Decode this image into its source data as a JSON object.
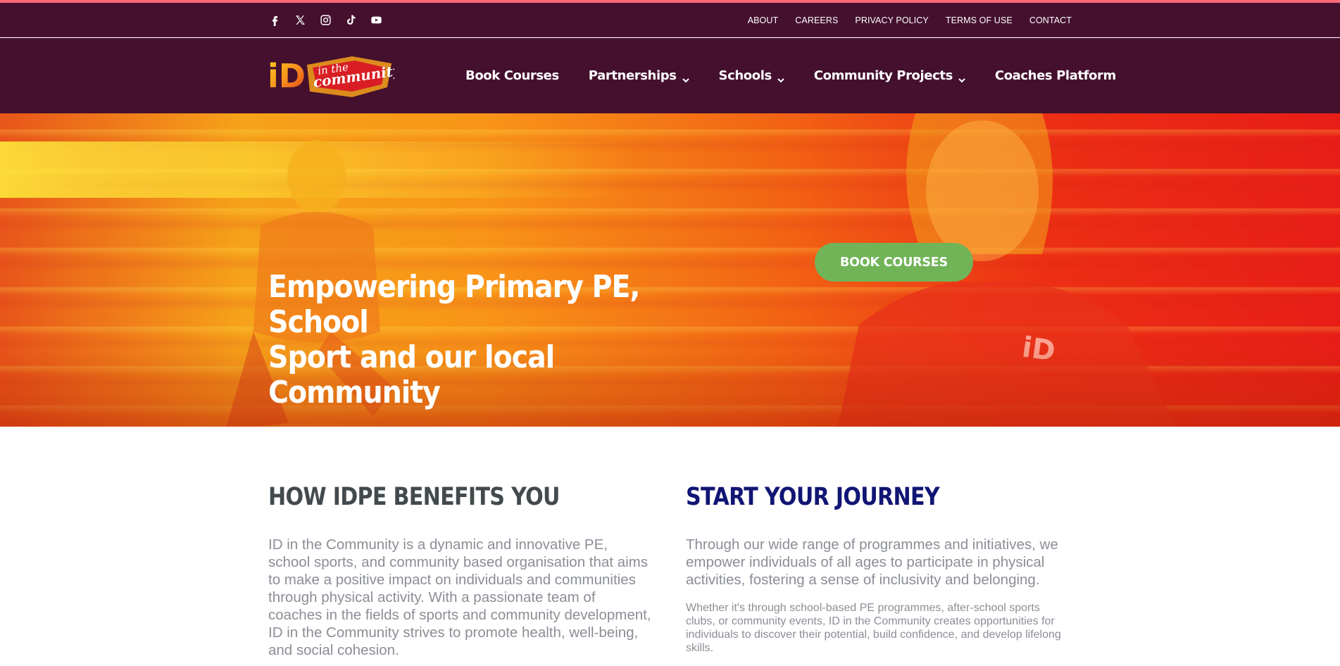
{
  "colors": {
    "topbar_bg": "#44102e",
    "accent_line": "#ff6a7a",
    "button_green": "#71b458",
    "heading_dark": "#424a4e",
    "heading_navy": "#111574",
    "body_text": "#8b8e96"
  },
  "social": [
    {
      "icon": "facebook-icon"
    },
    {
      "icon": "x-twitter-icon"
    },
    {
      "icon": "instagram-icon"
    },
    {
      "icon": "tiktok-icon"
    },
    {
      "icon": "youtube-icon"
    }
  ],
  "top_links": {
    "about": "ABOUT",
    "careers": "CAREERS",
    "privacy": "PRIVACY POLICY",
    "terms": "TERMS OF USE",
    "contact": "CONTACT"
  },
  "logo": {
    "mark": "iD",
    "script_line1": "in the",
    "script_line2": "community"
  },
  "nav": {
    "book_courses": "Book Courses",
    "partnerships": "Partnerships",
    "schools": "Schools",
    "community_projects": "Community Projects",
    "coaches_platform": "Coaches Platform"
  },
  "hero": {
    "title_line1": "Empowering Primary PE, School",
    "title_line2": "Sport and our local Community",
    "button_label": "BOOK COURSES",
    "shirt_logo": "iD"
  },
  "left_column": {
    "heading": "HOW IDPE BENEFITS YOU",
    "paragraph_1": "ID in the Community is a dynamic and innovative PE, school sports, and community based organisation that aims to make a positive impact on individuals and communities through physical activity. With a passionate team of coaches in the fields of sports and community development,",
    "paragraph_2": "ID in the Community strives to promote health, well-being, and social cohesion."
  },
  "right_column": {
    "heading": "START YOUR JOURNEY",
    "paragraph_1": "Through our wide range of programmes and initiatives, we empower individuals of all ages to participate in physical activities, fostering a sense of inclusivity and belonging.",
    "paragraph_2": "Whether it's through school-based PE programmes, after-school sports clubs, or community events, ID in the Community creates opportunities for individuals to discover their potential, build confidence, and develop lifelong skills."
  }
}
